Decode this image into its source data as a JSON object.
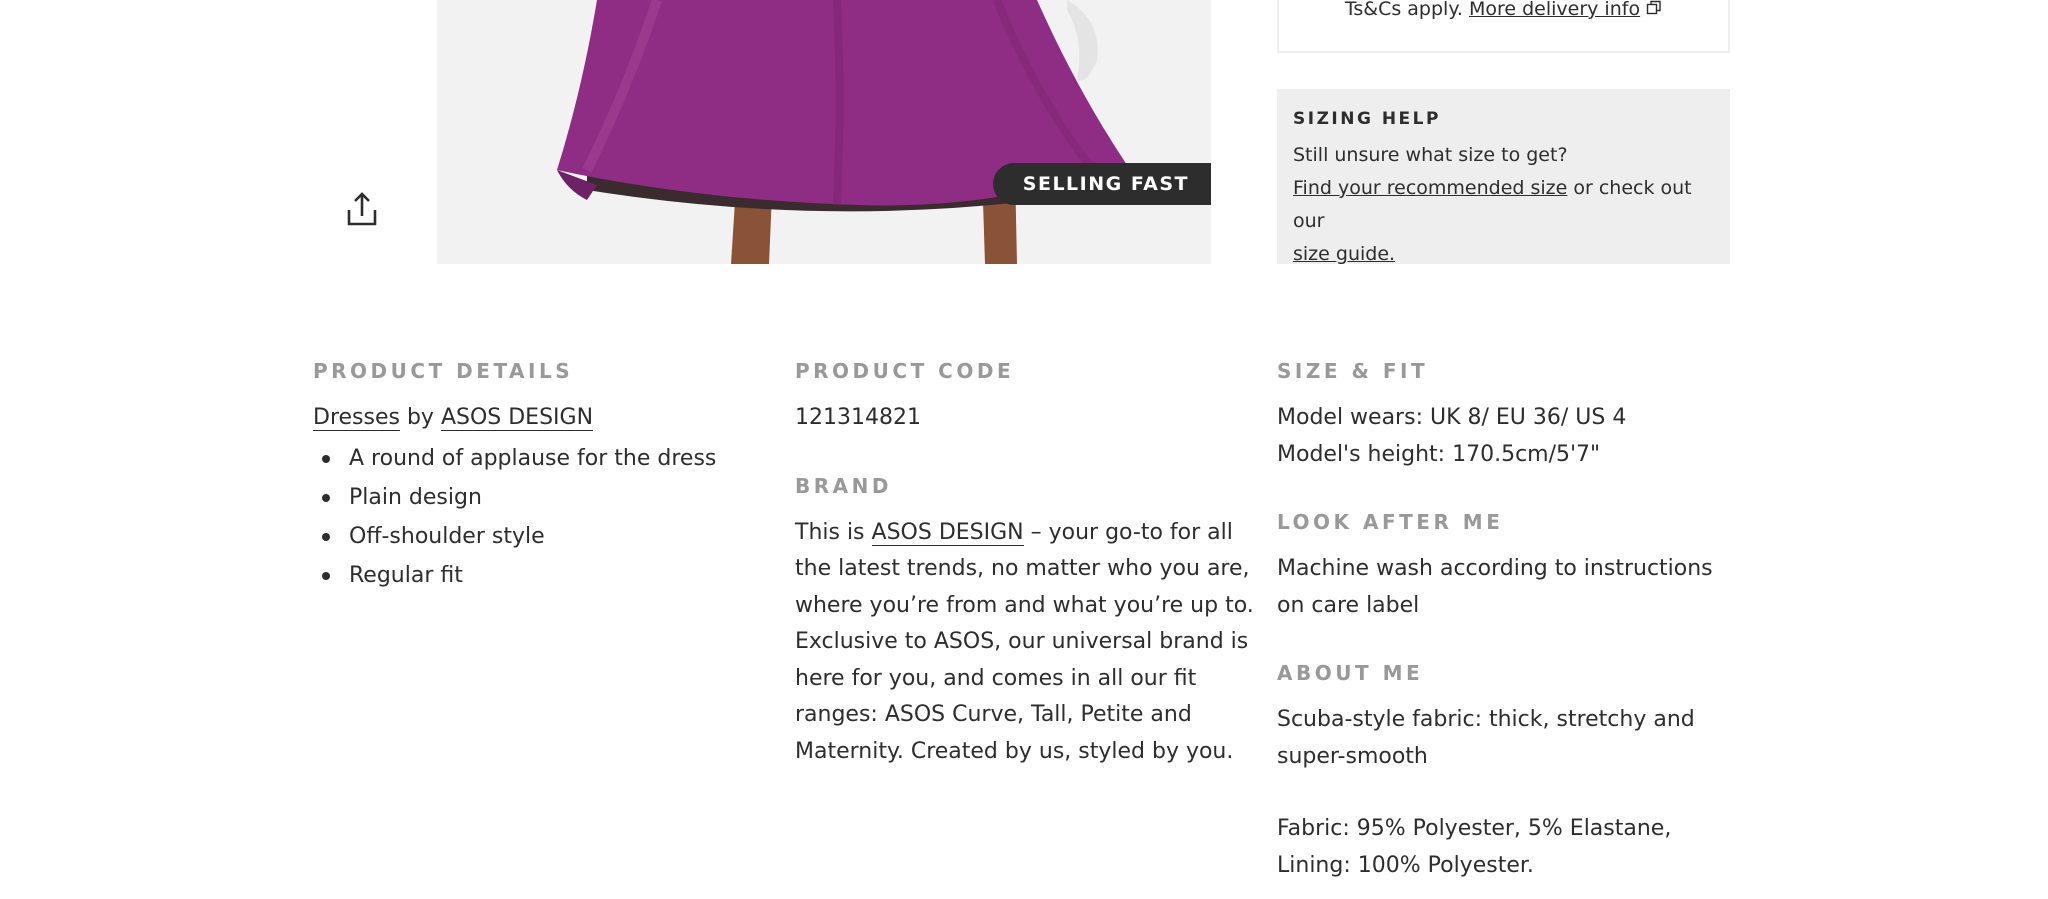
{
  "delivery": {
    "terms_text": "Ts&Cs apply.",
    "more_link": "More delivery info"
  },
  "badge": {
    "label": "SELLING FAST"
  },
  "sizing_help": {
    "heading": "SIZING HELP",
    "line1": "Still unsure what size to get?",
    "recommended_link": "Find your recommended size",
    "middle_text": " or check out our",
    "size_guide_link": "size guide."
  },
  "product_details": {
    "heading": "PRODUCT DETAILS",
    "category_link": "Dresses",
    "by_text": " by ",
    "brand_link": "ASOS DESIGN",
    "bullets": [
      "A round of applause for the dress",
      "Plain design",
      "Off-shoulder style",
      "Regular fit"
    ]
  },
  "product_code": {
    "heading": "PRODUCT CODE",
    "value": "121314821"
  },
  "brand": {
    "heading": "BRAND",
    "intro": "This is ",
    "brand_link": "ASOS DESIGN",
    "description": " – your go-to for all the latest trends, no matter who you are, where you’re from and what you’re up to. Exclusive to ASOS, our universal brand is here for you, and comes in all our fit ranges: ASOS Curve, Tall, Petite and Maternity. Created by us, styled by you."
  },
  "size_fit": {
    "heading": "SIZE & FIT",
    "model_wears": "Model wears: UK 8/ EU 36/ US 4",
    "model_height": "Model's height: 170.5cm/5'7\""
  },
  "look_after": {
    "heading": "LOOK AFTER ME",
    "text": "Machine wash according to instructions on care label"
  },
  "about_me": {
    "heading": "ABOUT ME",
    "text1": "Scuba-style fabric: thick, stretchy and super-smooth",
    "text2": "Fabric: 95% Polyester, 5% Elastane, Lining: 100% Polyester."
  },
  "colors": {
    "dress": "#8e2d83",
    "text": "#2d2d2d",
    "muted_heading": "#999999",
    "panel": "#eeeeee"
  }
}
